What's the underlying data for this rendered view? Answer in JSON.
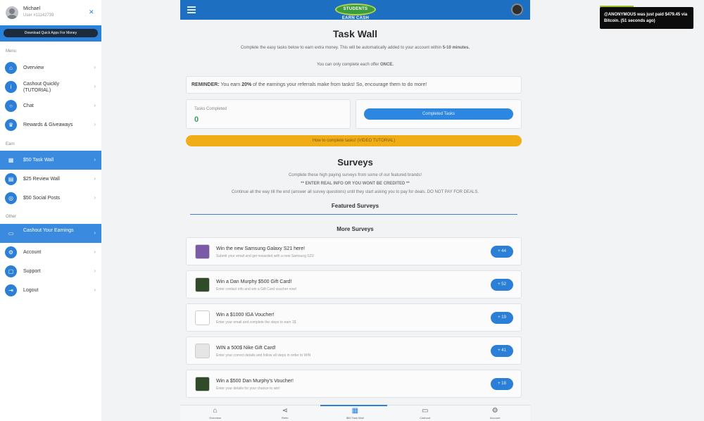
{
  "sidebar": {
    "user": {
      "name": "Michael",
      "id": "User #11142739"
    },
    "download_button": "Download Quick Apps For Money",
    "sections": {
      "menu": "Menu",
      "earn": "Earn",
      "other": "Other"
    },
    "menu_items": [
      {
        "label": "Overview",
        "icon": "home-icon"
      },
      {
        "label": "Cashout Quickly (TUTORIAL)",
        "icon": "info-icon"
      },
      {
        "label": "Chat",
        "icon": "chat-icon"
      },
      {
        "label": "Rewards & Giveaways",
        "icon": "trophy-icon"
      }
    ],
    "earn_items": [
      {
        "label": "$50 Task Wall",
        "icon": "grid-icon",
        "active": true
      },
      {
        "label": "$25 Review Wall",
        "icon": "document-icon"
      },
      {
        "label": "$50 Social Posts",
        "icon": "instagram-icon"
      }
    ],
    "other_items": [
      {
        "label": "Cashout Your Earnings",
        "icon": "wallet-icon",
        "active": true
      },
      {
        "label": "Account",
        "icon": "gear-icon"
      },
      {
        "label": "Support",
        "icon": "support-icon"
      },
      {
        "label": "Logout",
        "icon": "logout-icon"
      }
    ]
  },
  "header": {
    "logo_text": "STUDENTS EARN CASH"
  },
  "main": {
    "title": "Task Wall",
    "subtitle_pre": "Complete the easy tasks below to earn extra money. This will be automatically added to your account within ",
    "subtitle_bold": "5-10 minutes.",
    "once_pre": "You can only complete each offer ",
    "once_bold": "ONCE.",
    "reminder_label": "REMINDER:",
    "reminder_pre": " You earn ",
    "reminder_bold": "20%",
    "reminder_post": " of the earnings your referrals make from tasks! So, encourage them to do more!",
    "tasks_completed_label": "Tasks Completed",
    "tasks_completed_value": "0",
    "completed_tasks_button": "Completed Tasks",
    "howto_button": "How to complete tasks! (VIDEO TUTORIAL)",
    "surveys_title": "Surveys",
    "surveys_sub": "Complete these high paying surveys from some of our featured brands!",
    "surveys_warn": "** ENTER REAL INFO OR YOU WONT BE CREDITED **",
    "surveys_continue": "Continue all the way till the end (answer all survey questions) until they start asking you to pay for deals. DO NOT PAY FOR DEALS.",
    "featured_label": "Featured Surveys",
    "more_label": "More Surveys",
    "surveys": [
      {
        "title": "Win the new Samsung Galaxy S21 here!",
        "desc": "Submit your email and get rewarded with a new Samsung S21!",
        "reward": "+ 44",
        "icon": "samsung-phone-icon",
        "color": "#7b5ba6"
      },
      {
        "title": "Win a Dan Murphy $500 Gift Card!",
        "desc": "Enter contact info and win a Gift Card voucher now!",
        "reward": "+ 52",
        "icon": "dan-murphys-icon",
        "color": "#2f4b2a"
      },
      {
        "title": "Win a $1000 IGA Voucher!",
        "desc": "Enter your email and complete the steps to earn 1$",
        "reward": "+ 19",
        "icon": "iga-logo-icon",
        "color": "#ffffff"
      },
      {
        "title": "WIN a 500$ Nike Gift Card!",
        "desc": "Enter your correct details and follow all steps in order to WIN",
        "reward": "+ 41",
        "icon": "nike-card-icon",
        "color": "#e5e5e5"
      },
      {
        "title": "Win a $500 Dan Murphy's Voucher!",
        "desc": "Enter your details for your chance to win!",
        "reward": "+ 18",
        "icon": "dan-murphys-icon",
        "color": "#2f4b2a"
      }
    ]
  },
  "bottom_nav": [
    {
      "label": "Overview",
      "icon": "home-icon"
    },
    {
      "label": "Refer",
      "icon": "share-icon"
    },
    {
      "label": "$50 Task Wall",
      "icon": "grid-icon",
      "active": true
    },
    {
      "label": "Cashout",
      "icon": "wallet-icon"
    },
    {
      "label": "Account",
      "icon": "gear-icon"
    }
  ],
  "toast": {
    "text": "@ANONYMOUS was just paid $479.45 via Bitcoin. (51 seconds ago)"
  }
}
